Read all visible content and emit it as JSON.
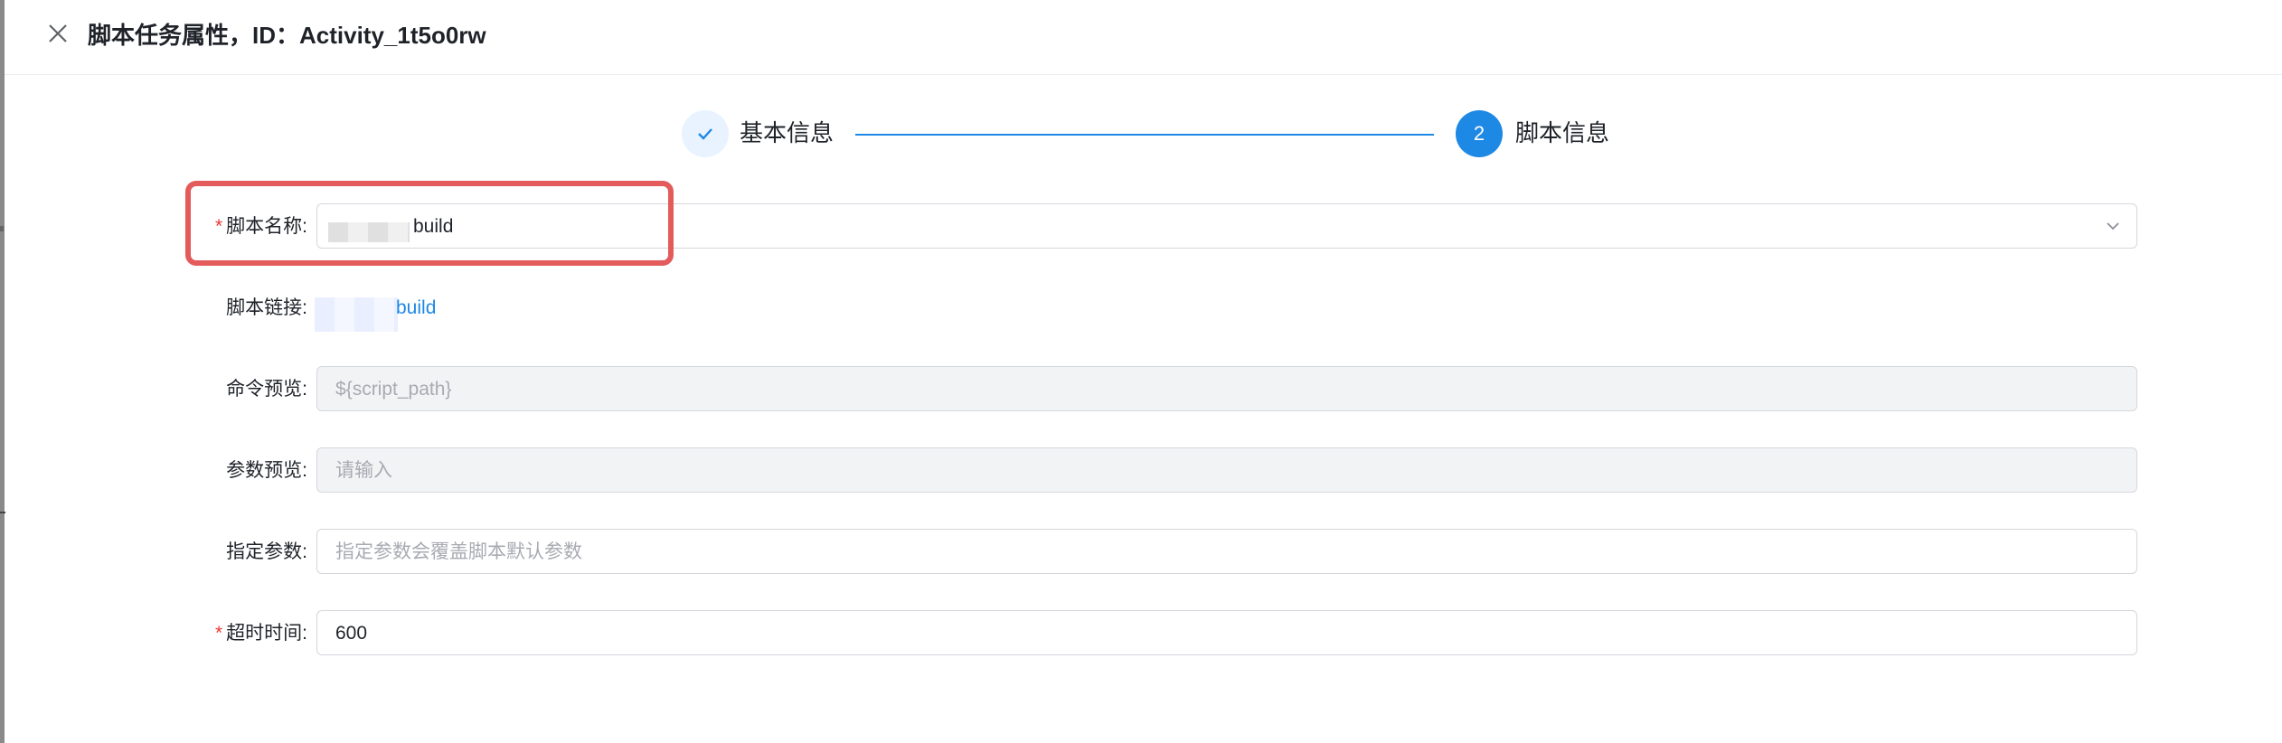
{
  "header": {
    "title": "脚本任务属性，ID：Activity_1t5o0rw",
    "close_icon": "close-icon"
  },
  "steps": [
    {
      "label": "基本信息",
      "status": "done",
      "icon": "check-icon"
    },
    {
      "label": "脚本信息",
      "status": "current",
      "number": "2"
    }
  ],
  "form": {
    "script_name": {
      "label": "脚本名称:",
      "required_mark": "*",
      "value": "build",
      "icon": "chevron-down-icon"
    },
    "script_link": {
      "label": "脚本链接:",
      "value": "build"
    },
    "command_preview": {
      "label": "命令预览:",
      "placeholder": "${script_path}"
    },
    "param_preview": {
      "label": "参数预览:",
      "placeholder": "请输入"
    },
    "specified_params": {
      "label": "指定参数:",
      "placeholder": "指定参数会覆盖脚本默认参数"
    },
    "timeout": {
      "label": "超时时间:",
      "required_mark": "*",
      "value": "600"
    }
  },
  "colors": {
    "primary": "#1e88e5",
    "required": "#e53935",
    "highlight": "#e35b5b"
  }
}
